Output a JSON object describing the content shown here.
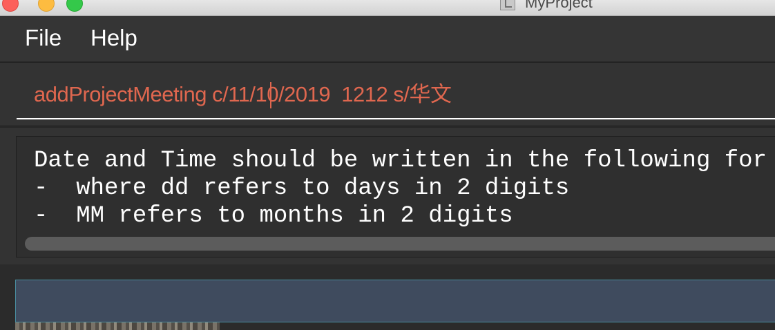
{
  "window": {
    "title": "MyProject"
  },
  "menu": {
    "file": "File",
    "help": "Help"
  },
  "command": {
    "text": "addProjectMeeting c/11/10/2019  1212 s/华文"
  },
  "result": {
    "lines": [
      "Date and Time should be written in the following for",
      "-  where dd refers to days in 2 digits",
      "-  MM refers to months in 2 digits"
    ]
  },
  "colors": {
    "command_text": "#e0674f",
    "menu_bg": "#353535",
    "list_header": "#3f4b5e"
  }
}
